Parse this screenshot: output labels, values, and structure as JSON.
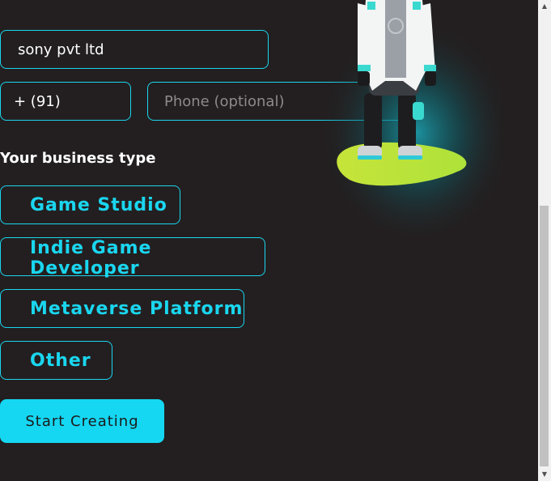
{
  "form": {
    "company_name_value": "sony pvt ltd",
    "country_code_value": "+ (91)",
    "phone_placeholder": "Phone (optional)",
    "business_type_label": "Your business type",
    "business_types": [
      "Game Studio",
      "Indie Game Developer",
      "Metaverse Platform",
      "Other"
    ],
    "submit_label": "Start Creating"
  },
  "scrollbar": {
    "up_arrow": "▲",
    "down_arrow": "▼"
  },
  "colors": {
    "accent": "#1ad6ef",
    "background": "#231f20",
    "cta_background": "#15d7f2"
  }
}
